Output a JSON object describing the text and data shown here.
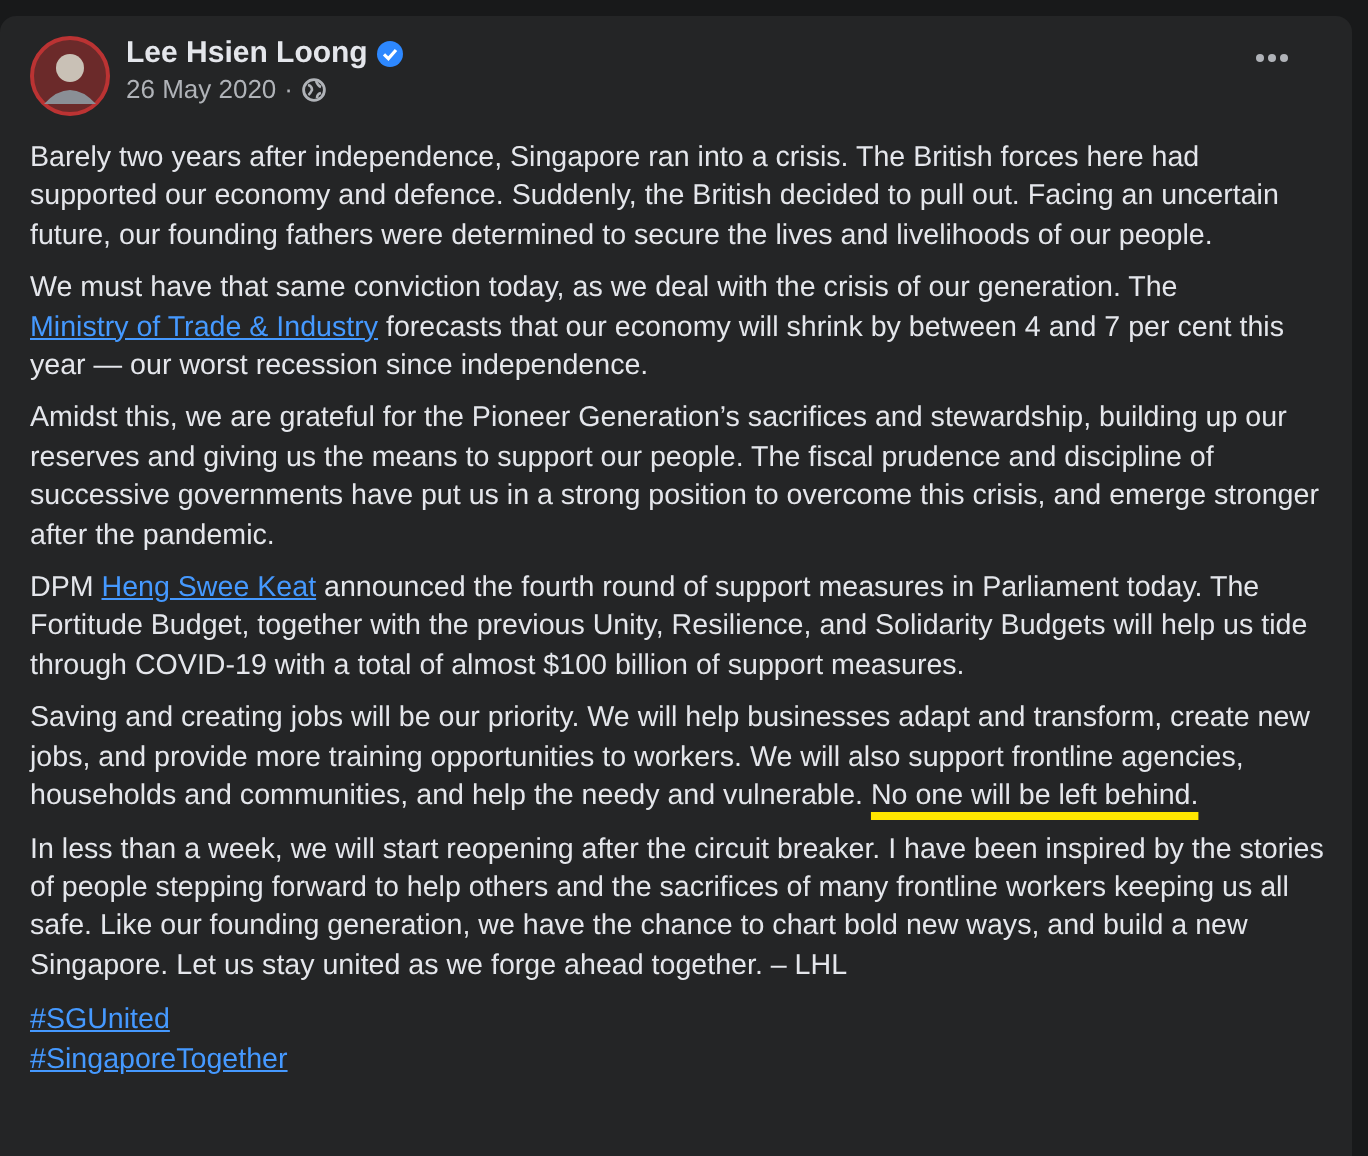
{
  "post": {
    "author": "Lee Hsien Loong",
    "verified": true,
    "date": "26 May 2020",
    "separator": "·",
    "paragraphs": [
      [
        {
          "kind": "plain",
          "text": "Barely two years after independence, Singapore ran into a crisis. The British forces here had supported our economy and defence. Suddenly, the British decided to pull out. Facing an uncertain future, our founding fathers were determined to secure the lives and livelihoods of our people."
        }
      ],
      [
        {
          "kind": "plain",
          "text": "We must have that same conviction today, as we deal with the crisis of our generation. The "
        },
        {
          "kind": "link",
          "text": "Ministry of Trade & Industry"
        },
        {
          "kind": "plain",
          "text": " forecasts that our economy will shrink by between 4 and 7 per cent this year — our worst recession since independence."
        }
      ],
      [
        {
          "kind": "plain",
          "text": "Amidst this, we are grateful for the Pioneer Generation’s sacrifices and stewardship, building up our reserves and giving us the means to support our people. The fiscal prudence and discipline of successive governments have put us in a strong position to overcome this crisis, and emerge stronger after the pandemic."
        }
      ],
      [
        {
          "kind": "plain",
          "text": "DPM "
        },
        {
          "kind": "link",
          "text": "Heng Swee Keat"
        },
        {
          "kind": "plain",
          "text": " announced the fourth round of support measures in Parliament today. The Fortitude Budget, together with the previous Unity, Resilience, and Solidarity Budgets will help us tide through COVID-19 with a total of almost $100 billion of support measures."
        }
      ],
      [
        {
          "kind": "plain",
          "text": "Saving and creating jobs will be our priority. We will help businesses adapt and transform, create new jobs, and provide more training opportunities to workers. We will also support frontline agencies, households and communities, and help the needy and vulnerable. "
        },
        {
          "kind": "underlined",
          "text": "No one will be left behind."
        }
      ],
      [
        {
          "kind": "plain",
          "text": "In less than a week, we will start reopening after the circuit breaker. I have been inspired by the stories of people stepping forward to help others and the sacrifices of many frontline workers keeping us all safe. Like our founding generation, we have the chance to chart bold new ways, and build a new Singapore. Let us stay united as we forge ahead together. – LHL"
        }
      ]
    ],
    "hashtags": [
      "#SGUnited",
      "#SingaporeTogether"
    ]
  }
}
